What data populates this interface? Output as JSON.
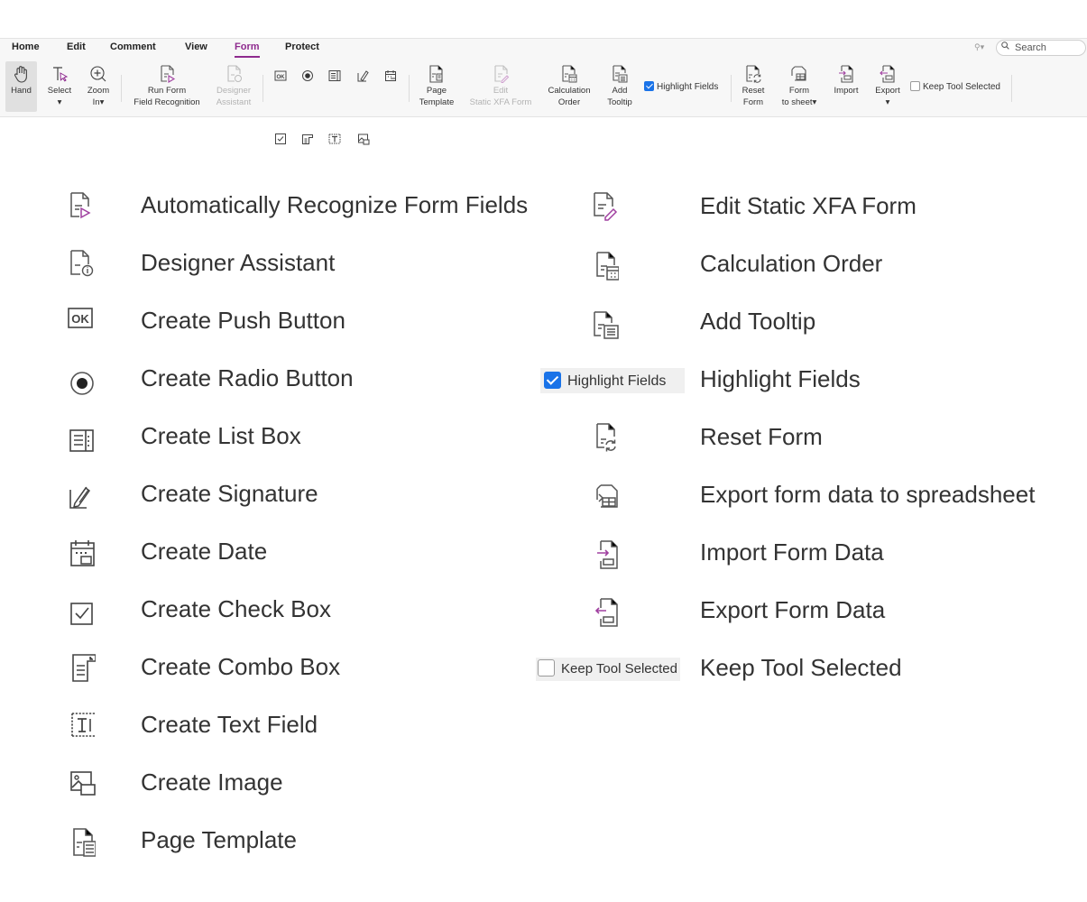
{
  "tabs": [
    "Home",
    "Edit",
    "Comment",
    "View",
    "Form",
    "Protect"
  ],
  "active_tab": "Form",
  "search": {
    "placeholder": "Search"
  },
  "ribbon": {
    "hand": "Hand",
    "select": "Select",
    "zoom_in": [
      "Zoom",
      "In▾"
    ],
    "run_form": [
      "Run Form",
      "Field Recognition"
    ],
    "designer": [
      "Designer",
      "Assistant"
    ],
    "page_template": [
      "Page",
      "Template"
    ],
    "edit_xfa": [
      "Edit",
      "Static XFA Form"
    ],
    "calc_order": [
      "Calculation",
      "Order"
    ],
    "add_tooltip": [
      "Add",
      "Tooltip"
    ],
    "highlight_fields": "Highlight Fields",
    "reset_form": [
      "Reset",
      "Form"
    ],
    "form_to_sheet": [
      "Form",
      "to sheet▾"
    ],
    "import": "Import",
    "export": "Export",
    "keep_tool": "Keep Tool Selected"
  },
  "legend": {
    "left": [
      {
        "icon": "run-form-recognition-icon",
        "label": "Automatically Recognize Form Fields"
      },
      {
        "icon": "designer-assistant-icon",
        "label": "Designer Assistant"
      },
      {
        "icon": "push-button-icon",
        "label": "Create Push Button"
      },
      {
        "icon": "radio-button-icon",
        "label": "Create Radio Button"
      },
      {
        "icon": "list-box-icon",
        "label": "Create List Box"
      },
      {
        "icon": "signature-icon",
        "label": "Create Signature"
      },
      {
        "icon": "date-icon",
        "label": "Create Date"
      },
      {
        "icon": "check-box-icon",
        "label": "Create Check Box"
      },
      {
        "icon": "combo-box-icon",
        "label": "Create Combo Box"
      },
      {
        "icon": "text-field-icon",
        "label": "Create Text Field"
      },
      {
        "icon": "image-icon",
        "label": "Create Image"
      },
      {
        "icon": "page-template-icon",
        "label": "Page Template"
      }
    ],
    "right": [
      {
        "icon": "edit-xfa-icon",
        "label": "Edit Static XFA Form"
      },
      {
        "icon": "calculation-order-icon",
        "label": "Calculation Order"
      },
      {
        "icon": "add-tooltip-icon",
        "label": "Add Tooltip"
      },
      {
        "icon": "highlight-fields-checkbox",
        "label": "Highlight Fields",
        "sample": "Highlight Fields",
        "checked": true
      },
      {
        "icon": "reset-form-icon",
        "label": "Reset Form"
      },
      {
        "icon": "form-to-sheet-icon",
        "label": "Export form data to spreadsheet"
      },
      {
        "icon": "import-form-icon",
        "label": "Import Form Data"
      },
      {
        "icon": "export-form-icon",
        "label": "Export Form Data"
      },
      {
        "icon": "keep-tool-checkbox",
        "label": "Keep Tool Selected",
        "sample": "Keep Tool Selected",
        "checked": false
      }
    ]
  },
  "colors": {
    "accent": "#8e2a8e",
    "check": "#1a73e8",
    "icon_stroke": "#555555",
    "icon_accent": "#a040a0"
  }
}
